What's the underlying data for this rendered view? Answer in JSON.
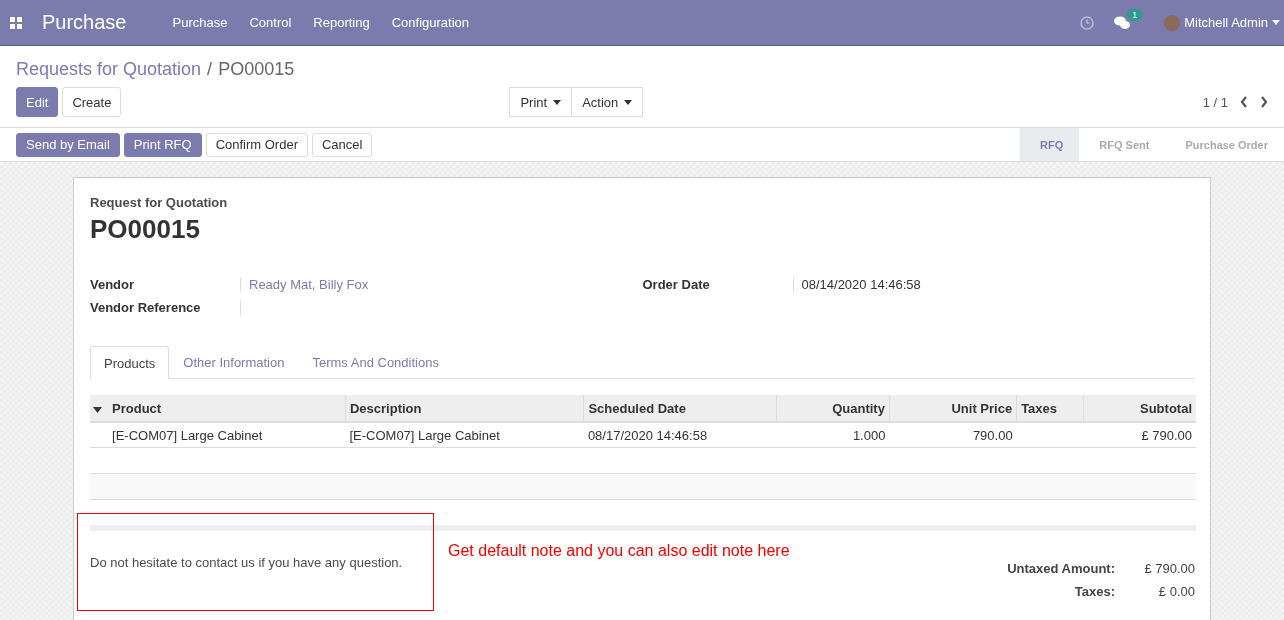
{
  "navbar": {
    "app_title": "Purchase",
    "menus": [
      "Purchase",
      "Control",
      "Reporting",
      "Configuration"
    ],
    "messages_badge": "1",
    "user": "Mitchell Admin"
  },
  "breadcrumb": {
    "parent": "Requests for Quotation",
    "separator": "/",
    "current": "PO00015"
  },
  "main_buttons": [
    {
      "label": "Edit",
      "kind": "primary"
    },
    {
      "label": "Create",
      "kind": "secondary"
    }
  ],
  "dropdowns": [
    "Print",
    "Action"
  ],
  "pager": "1 / 1",
  "action_buttons": [
    {
      "label": "Send by Email",
      "kind": "primary"
    },
    {
      "label": "Print RFQ",
      "kind": "primary"
    },
    {
      "label": "Confirm Order",
      "kind": "secondary"
    },
    {
      "label": "Cancel",
      "kind": "secondary"
    }
  ],
  "statusbar": [
    {
      "label": "RFQ",
      "selected": true
    },
    {
      "label": "RFQ Sent",
      "selected": false
    },
    {
      "label": "Purchase Order",
      "selected": false
    }
  ],
  "sheet": {
    "subtitle": "Request for Quotation",
    "name": "PO00015",
    "left_fields": [
      {
        "label": "Vendor",
        "value": "Ready Mat, Billy Fox"
      },
      {
        "label": "Vendor Reference"
      }
    ],
    "right_fields": [
      {
        "label": "Order Date",
        "value": "08/14/2020 14:46:58"
      }
    ],
    "tabs": [
      {
        "label": "Products",
        "selected": true
      },
      {
        "label": "Other Information",
        "selected": false
      },
      {
        "label": "Terms And Conditions",
        "selected": false
      }
    ],
    "table": {
      "columns": [
        "Product",
        "Description",
        "Scheduled Date",
        "Quantity",
        "Unit Price",
        "Taxes",
        "Subtotal"
      ],
      "rows": [
        [
          "[E-COM07] Large Cabinet",
          "[E-COM07] Large Cabinet",
          "08/17/2020 14:46:58",
          "1.000",
          "790.00",
          "",
          "£ 790.00"
        ]
      ]
    },
    "note": "Do not hesitate to contact us if you have any question.",
    "annotation": "Get default note and you can also edit note here",
    "totals": [
      {
        "label": "Untaxed Amount:",
        "value": "£ 790.00"
      },
      {
        "label": "Taxes:",
        "value": "£ 0.00"
      }
    ]
  }
}
